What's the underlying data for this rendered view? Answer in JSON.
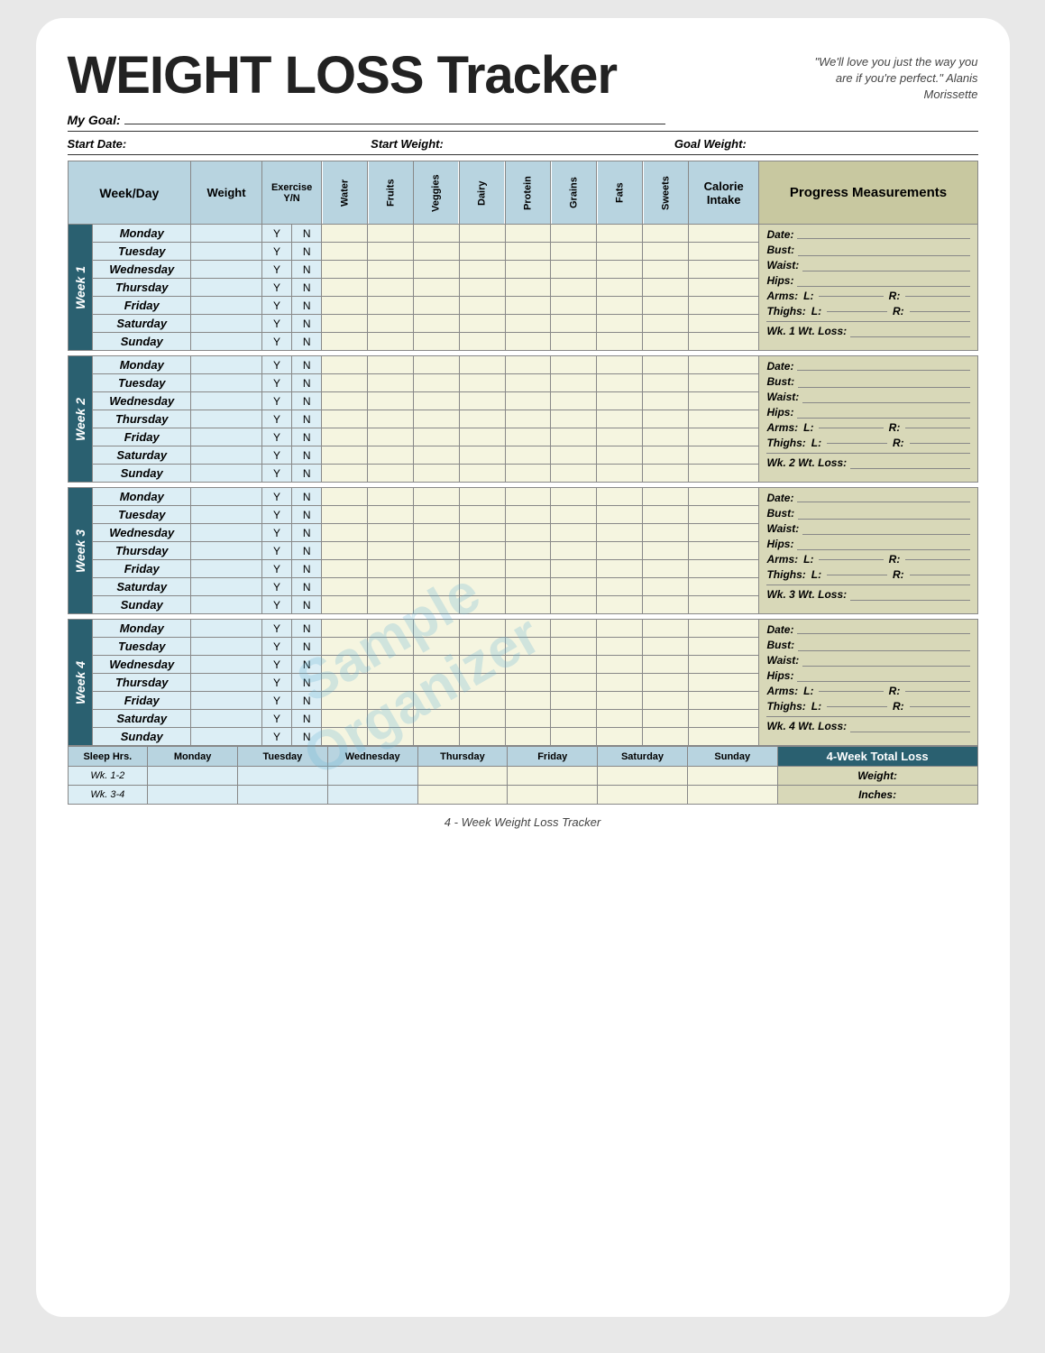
{
  "page": {
    "title": "WEIGHT LOSS Tracker",
    "quote": "\"We'll love you just the way you are if you're perfect.\" Alanis Morissette",
    "goal_label": "My Goal:",
    "start_date_label": "Start Date:",
    "start_weight_label": "Start Weight:",
    "goal_weight_label": "Goal Weight:",
    "watermark_line1": "Sample",
    "watermark_line2": "Organizer",
    "footer": "4 - Week Weight Loss Tracker"
  },
  "table_headers": {
    "week_day": "Week/Day",
    "weight": "Weight",
    "exercise": "Exercise Y/N",
    "water": "Water",
    "fruits": "Fruits",
    "veggies": "Veggies",
    "dairy": "Dairy",
    "protein": "Protein",
    "grains": "Grains",
    "fats": "Fats",
    "sweets": "Sweets",
    "calorie_intake": "Calorie Intake",
    "progress": "Progress Measurements"
  },
  "weeks": [
    {
      "label": "Week 1",
      "days": [
        "Monday",
        "Tuesday",
        "Wednesday",
        "Thursday",
        "Friday",
        "Saturday",
        "Sunday"
      ],
      "progress": {
        "date_label": "Date:",
        "bust_label": "Bust:",
        "waist_label": "Waist:",
        "hips_label": "Hips:",
        "arms_label": "Arms:",
        "arms_l": "L:",
        "arms_r": "R:",
        "thighs_label": "Thighs:",
        "thighs_l": "L:",
        "thighs_r": "R:",
        "wt_loss_label": "Wk. 1 Wt. Loss:"
      }
    },
    {
      "label": "Week 2",
      "days": [
        "Monday",
        "Tuesday",
        "Wednesday",
        "Thursday",
        "Friday",
        "Saturday",
        "Sunday"
      ],
      "progress": {
        "date_label": "Date:",
        "bust_label": "Bust:",
        "waist_label": "Waist:",
        "hips_label": "Hips:",
        "arms_label": "Arms:",
        "arms_l": "L:",
        "arms_r": "R:",
        "thighs_label": "Thighs:",
        "thighs_l": "L:",
        "thighs_r": "R:",
        "wt_loss_label": "Wk. 2 Wt. Loss:"
      }
    },
    {
      "label": "Week 3",
      "days": [
        "Monday",
        "Tuesday",
        "Wednesday",
        "Thursday",
        "Friday",
        "Saturday",
        "Sunday"
      ],
      "progress": {
        "date_label": "Date:",
        "bust_label": "Bust:",
        "waist_label": "Waist:",
        "hips_label": "Hips:",
        "arms_label": "Arms:",
        "arms_l": "L:",
        "arms_r": "R:",
        "thighs_label": "Thighs:",
        "thighs_l": "L:",
        "thighs_r": "R:",
        "wt_loss_label": "Wk. 3 Wt. Loss:"
      }
    },
    {
      "label": "Week 4",
      "days": [
        "Monday",
        "Tuesday",
        "Wednesday",
        "Thursday",
        "Friday",
        "Saturday",
        "Sunday"
      ],
      "progress": {
        "date_label": "Date:",
        "bust_label": "Bust:",
        "waist_label": "Waist:",
        "hips_label": "Hips:",
        "arms_label": "Arms:",
        "arms_l": "L:",
        "arms_r": "R:",
        "thighs_label": "Thighs:",
        "thighs_l": "L:",
        "thighs_r": "R:",
        "wt_loss_label": "Wk. 4 Wt. Loss:"
      }
    }
  ],
  "sleep_row": {
    "header": "Sleep Hrs.",
    "days": [
      "Monday",
      "Tuesday",
      "Wednesday",
      "Thursday",
      "Friday",
      "Saturday",
      "Sunday"
    ],
    "wk12_label": "Wk. 1-2",
    "wk34_label": "Wk. 3-4"
  },
  "four_week": {
    "header": "4-Week Total Loss",
    "weight_label": "Weight:",
    "inches_label": "Inches:"
  }
}
